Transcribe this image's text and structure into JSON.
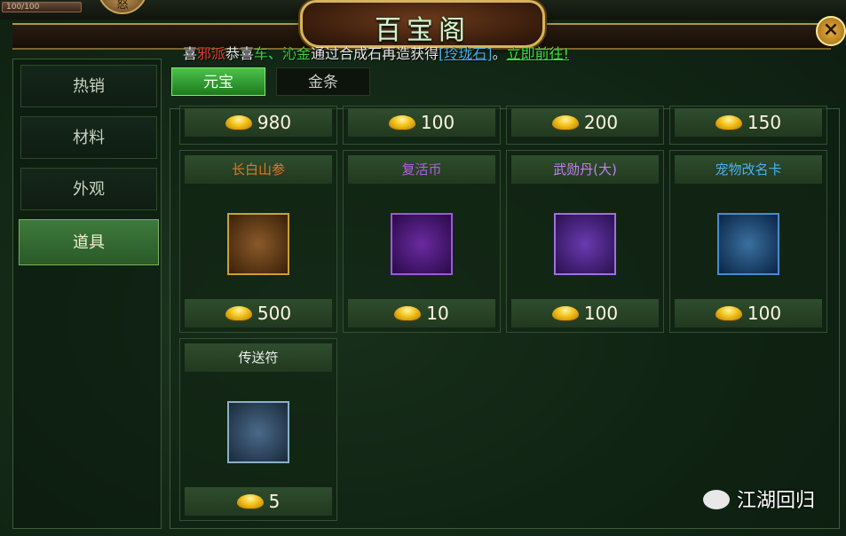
{
  "hud": {
    "hp_text": "100/100",
    "avatar_char": "怒"
  },
  "window": {
    "title": "百宝阁",
    "close_label": "×"
  },
  "announcement": {
    "prefix": "喜",
    "faction": "邪派",
    "congrats": "恭喜",
    "player": "车、沁金",
    "middle": "通过合成石再造获得",
    "item_link": "[玲珑石]",
    "sep": "。",
    "go_link": "立即前往!"
  },
  "categories": [
    {
      "label": "热销",
      "active": false
    },
    {
      "label": "材料",
      "active": false
    },
    {
      "label": "外观",
      "active": false
    },
    {
      "label": "道具",
      "active": true
    }
  ],
  "currency_tabs": [
    {
      "label": "元宝",
      "active": true
    },
    {
      "label": "金条",
      "active": false
    }
  ],
  "items_partial_row": [
    {
      "price": "980"
    },
    {
      "price": "100"
    },
    {
      "price": "200"
    },
    {
      "price": "150"
    }
  ],
  "items": [
    {
      "name": "长白山参",
      "name_color": "#e07a20",
      "icon": "ginseng-icon",
      "price": "500"
    },
    {
      "name": "复活币",
      "name_color": "#b060e0",
      "icon": "revive-coin-icon",
      "price": "10"
    },
    {
      "name": "武勋丹(大)",
      "name_color": "#c080f0",
      "icon": "merit-pill-icon",
      "price": "100"
    },
    {
      "name": "宠物改名卡",
      "name_color": "#4ab0f0",
      "icon": "pet-rename-card-icon",
      "price": "100"
    },
    {
      "name": "传送符",
      "name_color": "#f0f0f0",
      "icon": "teleport-talisman-icon",
      "price": "5"
    }
  ],
  "watermark": {
    "text": "江湖回归"
  }
}
